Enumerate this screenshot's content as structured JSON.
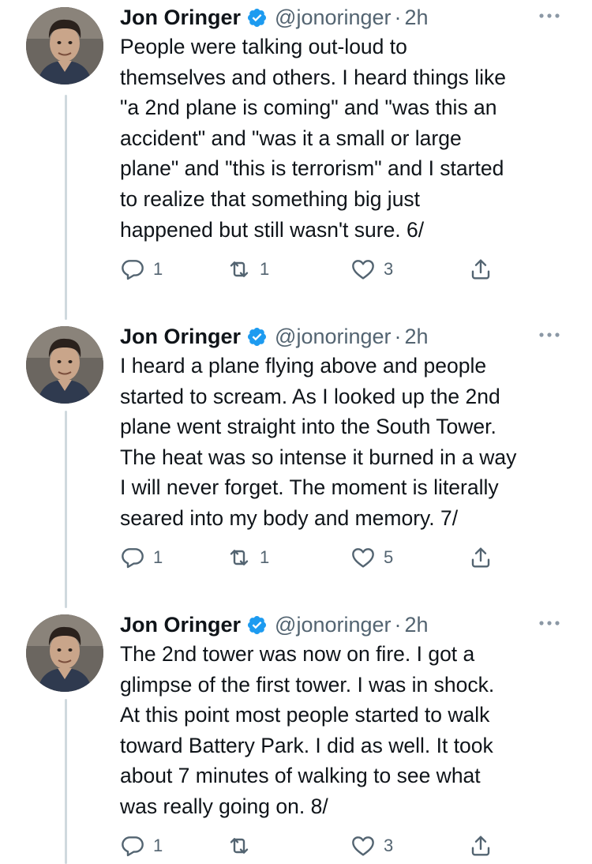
{
  "tweets": [
    {
      "name": "Jon Oringer",
      "handle": "@jonoringer",
      "separator": "·",
      "time": "2h",
      "text": "People were talking out-loud to\nthemselves and others. I heard  things like\n\"a 2nd plane is coming\" and \"was this an\naccident\" and \"was it a small or large\nplane\" and \"this is terrorism\" and I started\nto realize that something big just\nhappened but still wasn't sure. 6/",
      "replies": "1",
      "retweets": "1",
      "likes": "3"
    },
    {
      "name": "Jon Oringer",
      "handle": "@jonoringer",
      "separator": "·",
      "time": "2h",
      "text": "I heard a plane flying above and people\nstarted to scream. As I looked up the 2nd\nplane went straight into the South Tower.\nThe heat was so intense it burned in a way\nI will never forget. The moment is literally\nseared into my body and memory. 7/",
      "replies": "1",
      "retweets": "1",
      "likes": "5"
    },
    {
      "name": "Jon Oringer",
      "handle": "@jonoringer",
      "separator": "·",
      "time": "2h",
      "text": "The 2nd tower was now on fire. I got a\nglimpse of the first tower. I was in shock.\nAt this point most people started to walk\ntoward Battery Park. I did as well. It took\nabout 7 minutes of walking to see what\nwas really going on. 8/",
      "replies": "1",
      "retweets": "",
      "likes": "3"
    }
  ],
  "icons": {
    "reply": "reply-icon",
    "retweet": "retweet-icon",
    "like": "heart-icon",
    "share": "share-icon",
    "verified": "verified-badge-icon",
    "more": "more-options-icon"
  },
  "colors": {
    "text": "#0f1419",
    "secondary": "#536471",
    "verified": "#1d9bf0",
    "thread_line": "#cfd9de"
  }
}
